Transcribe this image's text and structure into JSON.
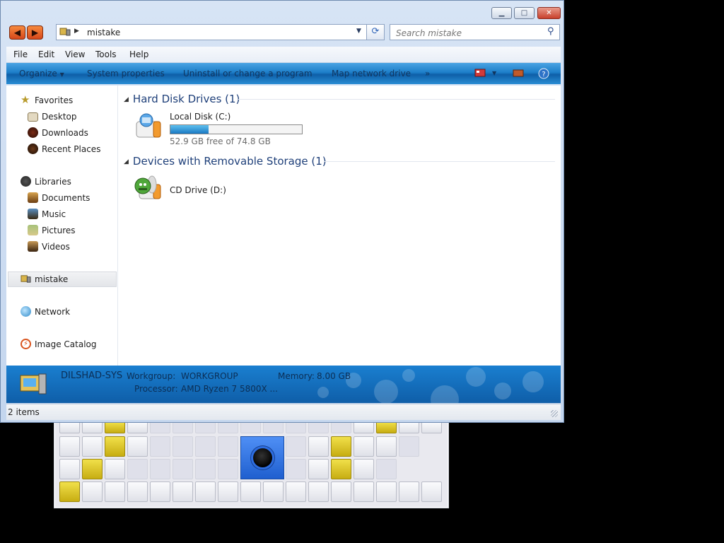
{
  "window": {
    "address_path": "mistake",
    "search_placeholder": "Search mistake"
  },
  "menubar": {
    "items": [
      "File",
      "Edit",
      "View",
      "Tools",
      "Help"
    ]
  },
  "command_bar": {
    "organize": "Organize",
    "system_properties": "System properties",
    "uninstall": "Uninstall or change a program",
    "map_network_drive": "Map network drive",
    "more": "»"
  },
  "nav": {
    "favorites": "Favorites",
    "desktop": "Desktop",
    "downloads": "Downloads",
    "recent_places": "Recent Places",
    "libraries": "Libraries",
    "documents": "Documents",
    "music": "Music",
    "pictures": "Pictures",
    "videos": "Videos",
    "computer": "mistake",
    "network": "Network",
    "image_catalog": "Image Catalog"
  },
  "content": {
    "hdd_group": "Hard Disk Drives (1)",
    "local_disk": {
      "name": "Local Disk (C:)",
      "free_text": "52.9 GB free of 74.8 GB",
      "used_fraction": 0.29
    },
    "removable_group": "Devices with Removable Storage (1)",
    "cd_drive": {
      "name": "CD Drive (D:)"
    }
  },
  "details": {
    "computer_name": "DILSHAD-SYS",
    "workgroup_label": "Workgroup:",
    "workgroup_value": "WORKGROUP",
    "memory_label": "Memory:",
    "memory_value": "8.00 GB",
    "processor_label": "Processor:",
    "processor_value": "AMD Ryzen 7 5800X ..."
  },
  "status": {
    "items_count": "2 items"
  },
  "colors": {
    "accent": "#1d7ec9",
    "tile_yellow": "#e0c620",
    "hole_blue": "#3a7ef0"
  }
}
